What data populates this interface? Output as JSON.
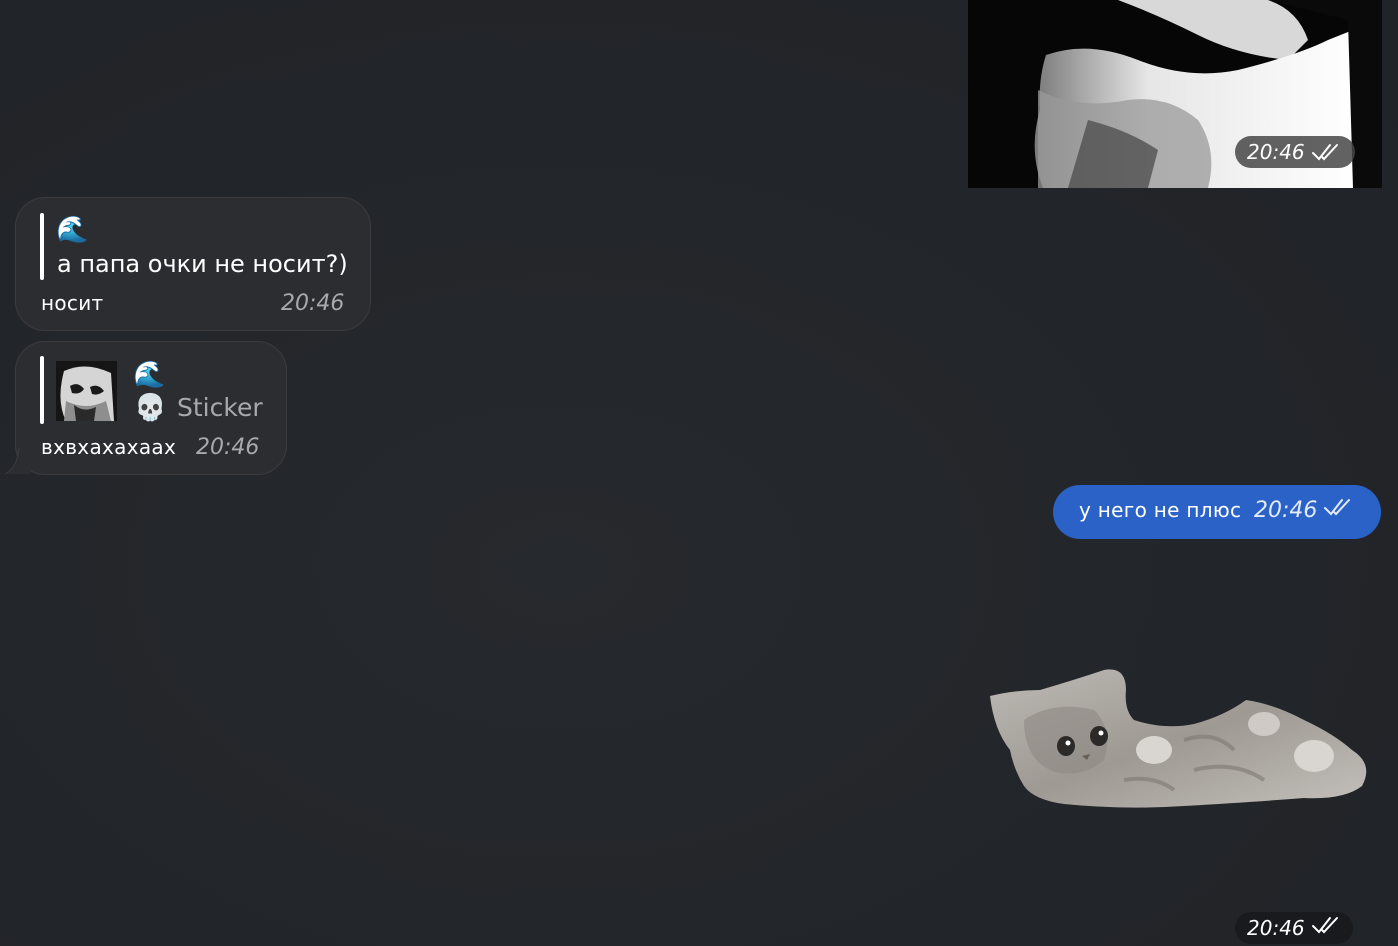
{
  "messages": {
    "top_media": {
      "time": "20:46",
      "status_icon": "double-check-icon"
    },
    "reply_1": {
      "quote_emoji": "🌊",
      "quote_text": "а папа очки не носит?)",
      "text": "носит",
      "time": "20:46"
    },
    "reply_2": {
      "quote_emoji": "🌊",
      "quote_type_emoji": "💀",
      "quote_label": "Sticker",
      "text": "вхвхахахаах",
      "time": "20:46"
    },
    "outgoing_1": {
      "text": "у него не плюс",
      "time": "20:46",
      "status_icon": "double-check-icon"
    },
    "sticker": {
      "description_icon": "kitten-sticker",
      "time": "20:46",
      "status_icon": "double-check-icon"
    }
  },
  "colors": {
    "background": "#222529",
    "incoming_bubble": "#2c2d30",
    "outgoing_bubble": "#2b62c8",
    "meta_text": "#a7a9ae"
  }
}
